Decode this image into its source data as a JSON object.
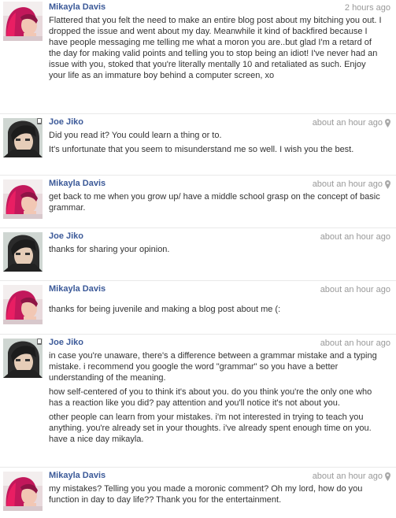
{
  "messages": [
    {
      "author": "Mikayla Davis",
      "time": "2 hours ago",
      "location_icon": false,
      "avatar": "mikayla",
      "paragraphs": [
        "Flattered that you felt the need to make an entire blog post about my bitching you out. I dropped the issue and went about my day. Meanwhile it kind of backfired because I have people messaging me telling me what a moron you are..but glad I'm a retard of the day for making valid points and telling you to stop being an idiot! I've never had an issue with you, stoked that you're literally mentally 10 and retaliated as such. Enjoy your life as an immature boy behind a computer screen, xo"
      ]
    },
    {
      "author": "Joe Jiko",
      "time": "about an hour ago",
      "location_icon": true,
      "avatar": "joe",
      "paragraphs": [
        "Did you read it? You could learn a thing or to.",
        "It's unfortunate that you seem to misunderstand me so well. I wish you the best."
      ]
    },
    {
      "author": "Mikayla Davis",
      "time": "about an hour ago",
      "location_icon": true,
      "avatar": "mikayla",
      "paragraphs": [
        "get back to me when you grow up/ have a middle school grasp on the concept of basic grammar."
      ]
    },
    {
      "author": "Joe Jiko",
      "time": "about an hour ago",
      "location_icon": false,
      "avatar": "joe",
      "paragraphs": [
        "thanks for sharing your opinion."
      ]
    },
    {
      "author": "Mikayla Davis",
      "time": "about an hour ago",
      "location_icon": false,
      "avatar": "mikayla",
      "paragraphs": [
        "thanks for being juvenile and making a blog post about me (:"
      ]
    },
    {
      "author": "Joe Jiko",
      "time": "about an hour ago",
      "location_icon": false,
      "avatar": "joe",
      "paragraphs": [
        "in case you're unaware, there's a difference between a grammar mistake and a typing mistake. i recommend you google the word \"grammar\" so you have a better understanding of the meaning.",
        "how self-centered of you to think it's about you. do you think you're the only one who has a reaction like you did? pay attention and you'll notice it's not about you.",
        "other people can learn from your mistakes. i'm not interested in trying to teach you anything. you're already set in your thoughts. i've already spent enough time on you. have a nice day mikayla."
      ]
    },
    {
      "author": "Mikayla Davis",
      "time": "about an hour ago",
      "location_icon": true,
      "avatar": "mikayla",
      "paragraphs": [
        "my mistakes? Telling you you made a moronic comment? Oh my lord, how do you function in day to day life?? Thank you for the entertainment."
      ]
    }
  ],
  "colors": {
    "name_link": "#3b5998",
    "timestamp": "#999999",
    "body_text": "#333333",
    "divider": "#e9e9e9"
  }
}
